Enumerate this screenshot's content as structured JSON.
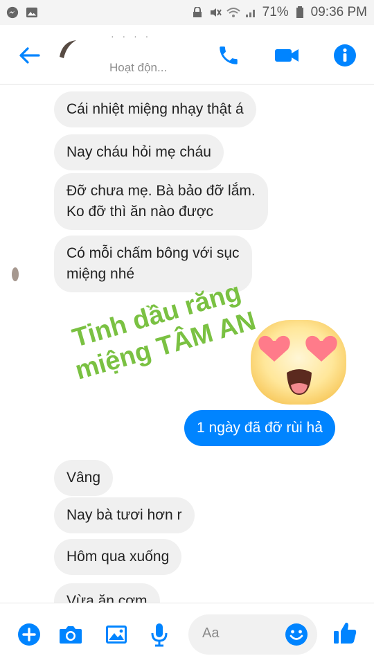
{
  "status_bar": {
    "battery": "71%",
    "time": "09:36 PM"
  },
  "header": {
    "contact_name": "· · · ·",
    "status": "Hoạt độn..."
  },
  "messages": [
    {
      "dir": "in",
      "text": "Cái nhiệt miệng nhạy thật á"
    },
    {
      "dir": "in",
      "text": "Nay cháu hỏi mẹ cháu"
    },
    {
      "dir": "in",
      "text": "Đỡ chưa mẹ. Bà bảo đỡ lắm.\nKo đỡ thì ăn nào được"
    },
    {
      "dir": "in",
      "text": "Có mỗi chấm bông với sục\nmiệng nhé"
    },
    {
      "dir": "out",
      "text": "1 ngày đã đỡ rùi hả"
    },
    {
      "dir": "in",
      "text": "Vâng"
    },
    {
      "dir": "in",
      "text": "Nay bà tươi hơn r"
    },
    {
      "dir": "in",
      "text": "Hôm qua xuống"
    },
    {
      "dir": "in",
      "text": "Vừa ăn cơm"
    }
  ],
  "watermark": {
    "line1": "Tinh dầu răng",
    "line2": "miệng TÂM AN"
  },
  "composer": {
    "placeholder": "Aa"
  },
  "icons": [
    "messenger-icon",
    "gallery-icon",
    "back-arrow-icon",
    "phone-icon",
    "video-icon",
    "info-icon",
    "plus-icon",
    "camera-icon",
    "image-icon",
    "mic-icon",
    "emoji-icon",
    "thumbs-up-icon",
    "heart-eyes-emoji"
  ],
  "colors": {
    "accent": "#0084ff",
    "incoming_bubble": "#f0f0f0",
    "watermark": "#7ac142"
  }
}
